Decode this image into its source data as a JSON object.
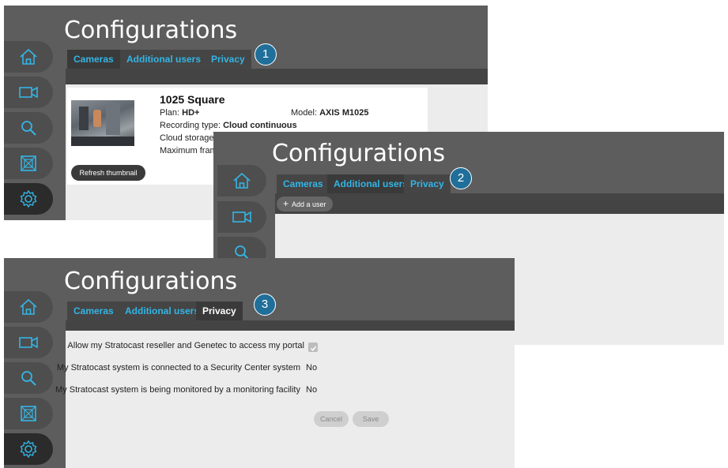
{
  "title": "Configurations",
  "tabs": {
    "cameras": "Cameras",
    "additional_users": "Additional users",
    "privacy": "Privacy"
  },
  "badges": [
    "1",
    "2",
    "3"
  ],
  "sidebar_icons": [
    "home-icon",
    "camera-icon",
    "search-icon",
    "layout-icon",
    "gear-icon"
  ],
  "accent_color": "#33b5e5",
  "panel1": {
    "camera": {
      "name": "1025 Square",
      "plan_label": "Plan:",
      "plan_value": "HD+",
      "model_label": "Model:",
      "model_value": "AXIS M1025",
      "recording_label": "Recording type:",
      "recording_value": "Cloud continuous",
      "storage_label": "Cloud storage:",
      "framerate_label": "Maximum fram",
      "refresh_button": "Refresh thumbnail"
    }
  },
  "panel2": {
    "add_user_button": "Add a user"
  },
  "panel3": {
    "privacy": {
      "access_label": "Allow my Stratocast reseller and Genetec to access my portal",
      "security_center_label": "My Stratocast system is connected to a Security Center system",
      "security_center_value": "No",
      "monitoring_label": "My Stratocast system is being monitored by a monitoring facility",
      "monitoring_value": "No",
      "cancel_button": "Cancel",
      "save_button": "Save"
    }
  }
}
